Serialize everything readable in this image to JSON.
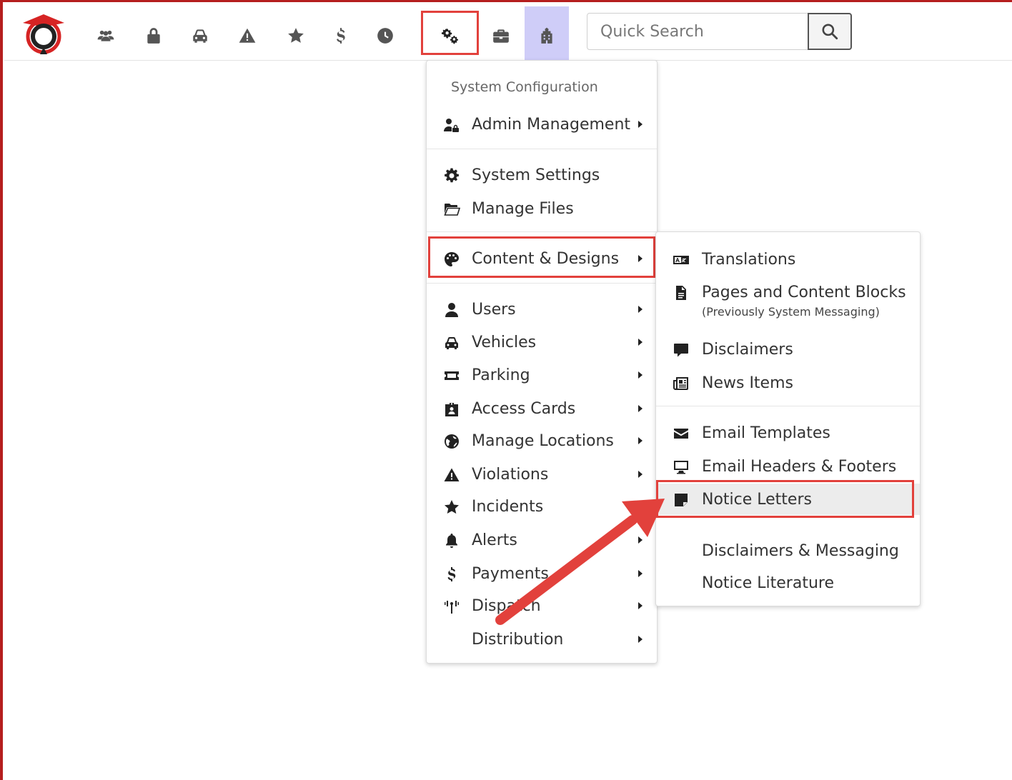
{
  "topnav": {
    "icons": [
      "users-icon",
      "lock-icon",
      "car-icon",
      "warning-icon",
      "star-icon",
      "dollar-icon",
      "clock-icon",
      "cogs-icon",
      "briefcase-icon",
      "building-icon"
    ],
    "active_icon": "building-icon",
    "highlighted_icon": "cogs-icon"
  },
  "search": {
    "placeholder": "Quick Search"
  },
  "main_menu": {
    "header": "System Configuration",
    "items": [
      {
        "label": "Admin Management",
        "icon": "user-lock-icon",
        "submenu": true
      },
      {
        "label": "System Settings",
        "icon": "gear-icon",
        "submenu": false
      },
      {
        "label": "Manage Files",
        "icon": "folder-open-icon",
        "submenu": false
      },
      {
        "label": "Content & Designs",
        "icon": "palette-icon",
        "submenu": true,
        "highlighted": true
      },
      {
        "label": "Users",
        "icon": "user-icon",
        "submenu": true
      },
      {
        "label": "Vehicles",
        "icon": "car-icon",
        "submenu": true
      },
      {
        "label": "Parking",
        "icon": "ticket-icon",
        "submenu": true
      },
      {
        "label": "Access Cards",
        "icon": "id-badge-icon",
        "submenu": true
      },
      {
        "label": "Manage Locations",
        "icon": "globe-icon",
        "submenu": true
      },
      {
        "label": "Violations",
        "icon": "warning-icon",
        "submenu": true
      },
      {
        "label": "Incidents",
        "icon": "star-icon",
        "submenu": true
      },
      {
        "label": "Alerts",
        "icon": "bell-icon",
        "submenu": true
      },
      {
        "label": "Payments",
        "icon": "dollar-icon",
        "submenu": true
      },
      {
        "label": "Dispatch",
        "icon": "broadcast-icon",
        "submenu": true
      },
      {
        "label": "Distribution",
        "icon": "",
        "submenu": true
      }
    ]
  },
  "sub_menu": {
    "items": [
      {
        "label": "Translations",
        "icon": "language-icon"
      },
      {
        "label": "Pages and Content Blocks",
        "icon": "file-icon",
        "note": "(Previously System Messaging)"
      },
      {
        "label": "Disclaimers",
        "icon": "comment-icon"
      },
      {
        "label": "News Items",
        "icon": "newspaper-icon"
      },
      {
        "label": "Email Templates",
        "icon": "envelope-icon"
      },
      {
        "label": "Email Headers & Footers",
        "icon": "desktop-icon"
      },
      {
        "label": "Notice Letters",
        "icon": "sticky-note-icon",
        "highlighted": true
      },
      {
        "label": "Disclaimers & Messaging",
        "icon": ""
      },
      {
        "label": "Notice Literature",
        "icon": ""
      }
    ]
  },
  "colors": {
    "highlight": "#e2413c",
    "active_nav": "#cfcdf8",
    "arrow": "#e2413c"
  }
}
